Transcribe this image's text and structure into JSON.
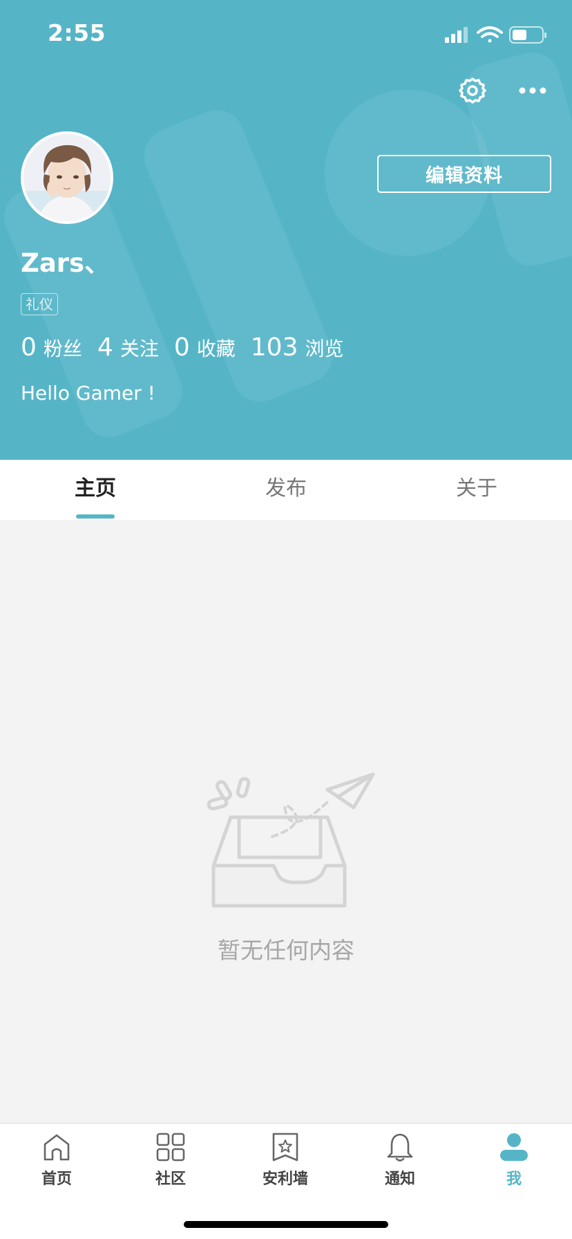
{
  "status_bar": {
    "time": "2:55"
  },
  "profile": {
    "username": "Zars、",
    "tag": "礼仪",
    "edit_button": "编辑资料",
    "bio": "Hello Gamer !",
    "stats": [
      {
        "value": "0",
        "label": "粉丝"
      },
      {
        "value": "4",
        "label": "关注"
      },
      {
        "value": "0",
        "label": "收藏"
      },
      {
        "value": "103",
        "label": "浏览"
      }
    ]
  },
  "tabs": [
    {
      "label": "主页",
      "active": true
    },
    {
      "label": "发布",
      "active": false
    },
    {
      "label": "关于",
      "active": false
    }
  ],
  "empty_state": {
    "text": "暂无任何内容"
  },
  "bottom_nav": [
    {
      "label": "首页",
      "icon": "home-icon"
    },
    {
      "label": "社区",
      "icon": "grid-icon"
    },
    {
      "label": "安利墙",
      "icon": "bookmark-star-icon"
    },
    {
      "label": "通知",
      "icon": "bell-icon"
    },
    {
      "label": "我",
      "icon": "person-icon",
      "active": true
    }
  ],
  "colors": {
    "accent": "#55b5c7",
    "background": "#f3f3f3"
  }
}
